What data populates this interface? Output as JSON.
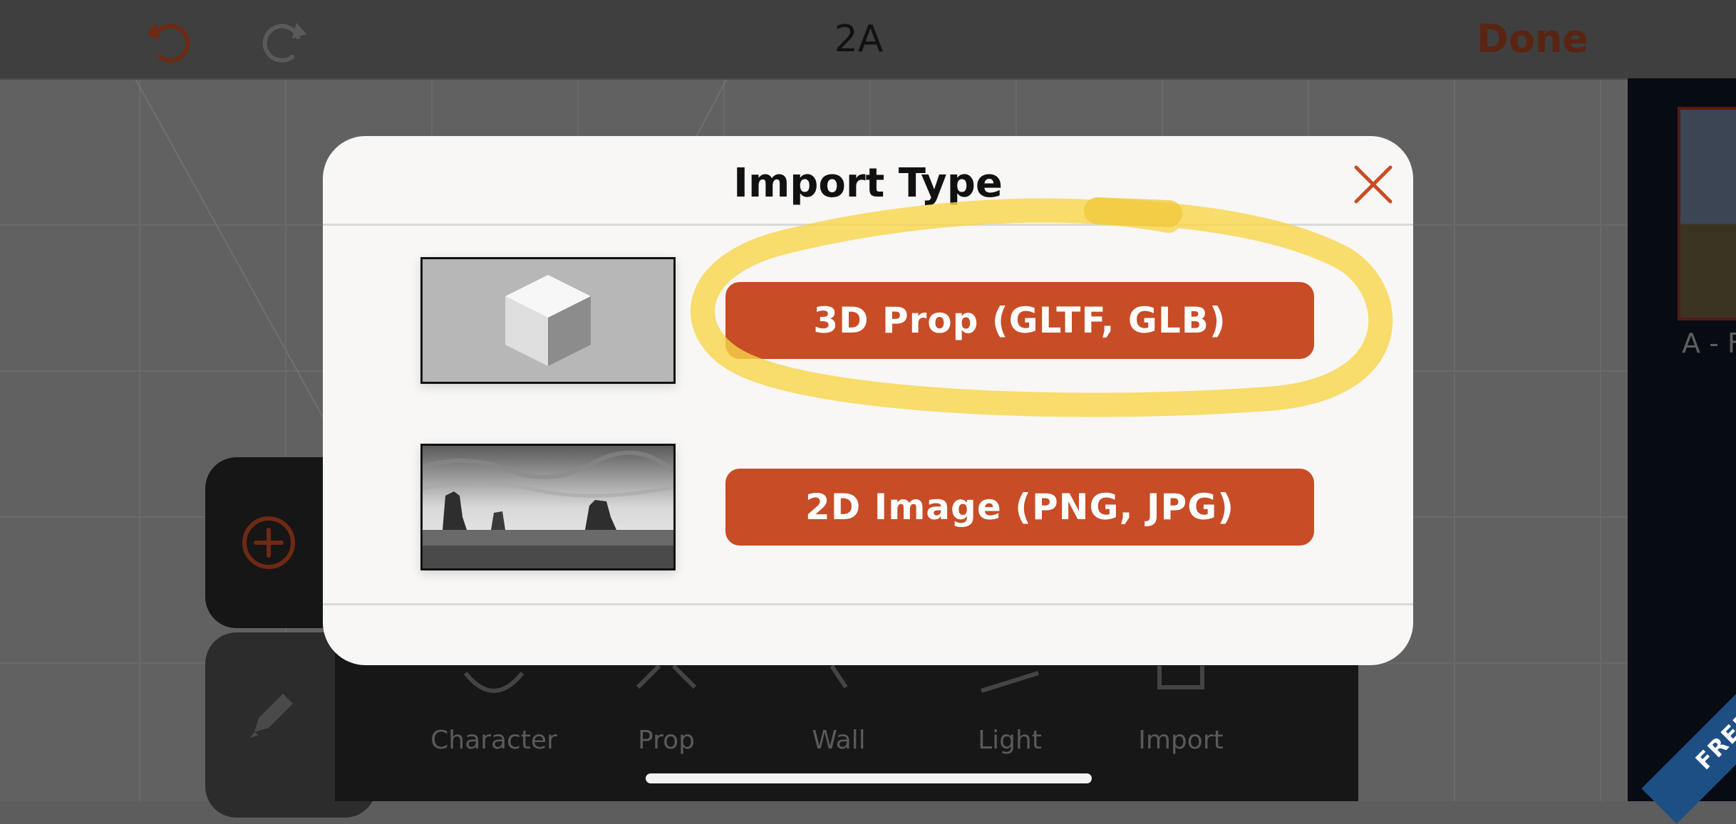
{
  "topbar": {
    "title": "2A",
    "done_label": "Done",
    "undo_icon": "undo-icon",
    "redo_icon": "redo-icon"
  },
  "colors": {
    "accent": "#c84c25",
    "highlight": "#f7d44a",
    "modal_bg": "#f8f7f5",
    "done_text": "#5a2412"
  },
  "toolbar": {
    "tools": [
      {
        "label": "Character",
        "icon": "character-icon"
      },
      {
        "label": "Prop",
        "icon": "prop-icon"
      },
      {
        "label": "Wall",
        "icon": "wall-icon"
      },
      {
        "label": "Light",
        "icon": "light-icon"
      },
      {
        "label": "Import",
        "icon": "import-icon"
      }
    ]
  },
  "right_panel": {
    "shot_label": "A - F",
    "badge": "FREE"
  },
  "modal": {
    "title": "Import Type",
    "close_icon": "close-icon",
    "options": [
      {
        "label": "3D Prop (GLTF, GLB)",
        "preview_icon": "cube-preview-image",
        "highlighted": true
      },
      {
        "label": "2D Image (PNG, JPG)",
        "preview_icon": "landscape-preview-image",
        "highlighted": false
      }
    ]
  }
}
